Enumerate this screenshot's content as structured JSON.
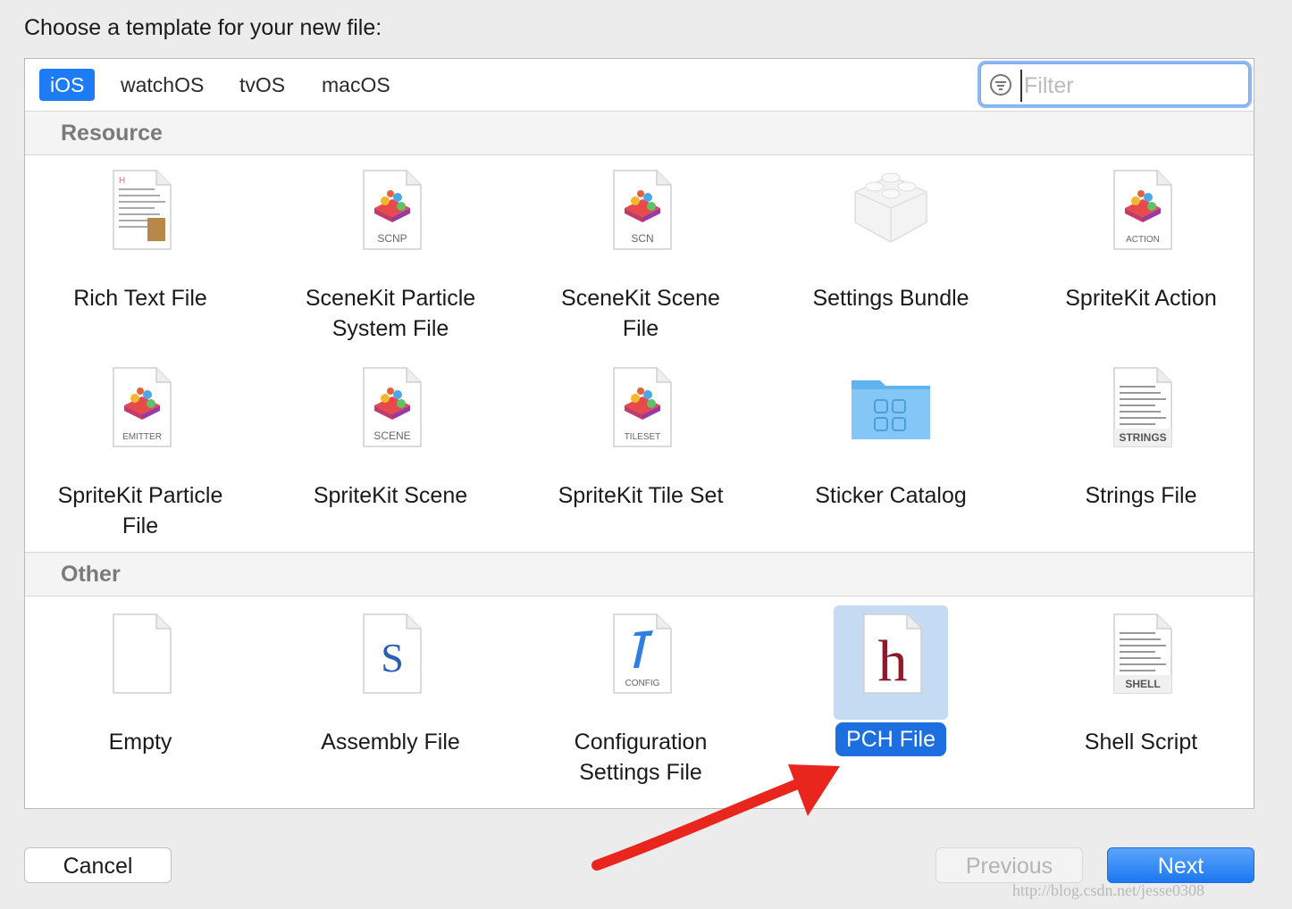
{
  "dialog": {
    "title": "Choose a template for your new file:"
  },
  "platform_tabs": [
    "iOS",
    "watchOS",
    "tvOS",
    "macOS"
  ],
  "selected_tab": "iOS",
  "filter": {
    "placeholder": "Filter",
    "value": ""
  },
  "sections": {
    "resource": {
      "title": "Resource",
      "items": [
        {
          "label_lines": [
            "Rich Text File"
          ],
          "icon": "rich-text-document-icon"
        },
        {
          "label_lines": [
            "SceneKit Particle",
            "System File"
          ],
          "icon": "scenekit-particle-icon",
          "badge": "SCNP"
        },
        {
          "label_lines": [
            "SceneKit Scene",
            "File"
          ],
          "icon": "scenekit-scene-icon",
          "badge": "SCN"
        },
        {
          "label_lines": [
            "Settings Bundle"
          ],
          "icon": "settings-bundle-lego-icon"
        },
        {
          "label_lines": [
            "SpriteKit Action"
          ],
          "icon": "spritekit-action-icon",
          "badge": "ACTION"
        },
        {
          "label_lines": [
            "SpriteKit Particle",
            "File"
          ],
          "icon": "spritekit-emitter-icon",
          "badge": "EMITTER"
        },
        {
          "label_lines": [
            "SpriteKit Scene"
          ],
          "icon": "spritekit-scene-icon",
          "badge": "SCENE"
        },
        {
          "label_lines": [
            "SpriteKit Tile Set"
          ],
          "icon": "spritekit-tileset-icon",
          "badge": "TILESET"
        },
        {
          "label_lines": [
            "Sticker Catalog"
          ],
          "icon": "sticker-catalog-folder-icon"
        },
        {
          "label_lines": [
            "Strings File"
          ],
          "icon": "strings-file-icon",
          "badge": "STRINGS"
        }
      ]
    },
    "other": {
      "title": "Other",
      "items": [
        {
          "label_lines": [
            "Empty"
          ],
          "icon": "empty-file-icon"
        },
        {
          "label_lines": [
            "Assembly File"
          ],
          "icon": "assembly-file-icon",
          "glyph": "S"
        },
        {
          "label_lines": [
            "Configuration",
            "Settings File"
          ],
          "icon": "config-file-icon",
          "badge": "CONFIG"
        },
        {
          "label_lines": [
            "PCH File"
          ],
          "icon": "pch-file-icon",
          "glyph": "h",
          "selected": true
        },
        {
          "label_lines": [
            "Shell Script"
          ],
          "icon": "shell-script-icon",
          "badge": "SHELL"
        }
      ]
    }
  },
  "buttons": {
    "cancel": "Cancel",
    "previous": "Previous",
    "next": "Next",
    "previous_disabled": true
  },
  "watermark": "http://blog.csdn.net/jesse0308",
  "colors": {
    "accent": "#1d7bf3",
    "selection_bg": "#c5dbf4",
    "arrow": "#e8261e"
  }
}
